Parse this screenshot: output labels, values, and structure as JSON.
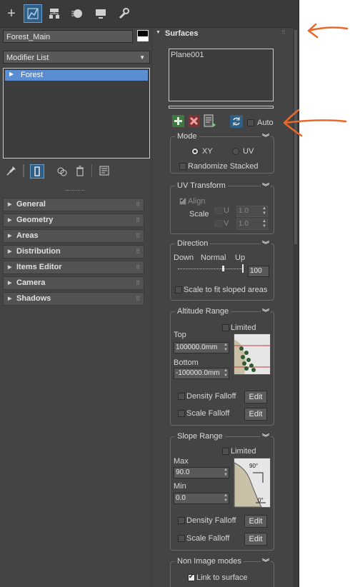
{
  "tabs": [
    {
      "icon": "plus-icon",
      "glyph": "+"
    },
    {
      "icon": "modify-icon",
      "glyph": "⬚"
    },
    {
      "icon": "hierarchy-icon",
      "glyph": "▀"
    },
    {
      "icon": "motion-icon",
      "glyph": "●"
    },
    {
      "icon": "display-icon",
      "glyph": "▬"
    },
    {
      "icon": "utilities-icon",
      "glyph": "🔧"
    }
  ],
  "object_name": "Forest_Main",
  "modifier_list": "Modifier List",
  "stack_item": "Forest",
  "rollups": [
    "General",
    "Geometry",
    "Areas",
    "Distribution",
    "Items Editor",
    "Camera",
    "Shadows"
  ],
  "surfaces": {
    "title": "Surfaces",
    "list_item": "Plane001",
    "auto_label": "Auto",
    "mode": {
      "title": "Mode",
      "xy": "XY",
      "uv": "UV",
      "randomize": "Randomize Stacked"
    },
    "uv_transform": {
      "title": "UV Transform",
      "align": "Align",
      "scale": "Scale",
      "u": "U",
      "v": "V",
      "u_value": "1.0",
      "v_value": "1.0"
    },
    "direction": {
      "title": "Direction",
      "down": "Down",
      "normal": "Normal",
      "up": "Up",
      "value": "100",
      "scale_slope": "Scale to fit sloped areas",
      "slider_level": 0.7
    },
    "altitude": {
      "title": "Altitude Range",
      "limited": "Limited",
      "top": "Top",
      "top_value": "100000.0mm",
      "bottom": "Bottom",
      "bottom_value": "-100000.0mm",
      "density_falloff": "Density Falloff",
      "scale_falloff": "Scale Falloff",
      "edit": "Edit"
    },
    "slope": {
      "title": "Slope Range",
      "limited": "Limited",
      "max": "Max",
      "max_value": "90.0",
      "min": "Min",
      "min_value": "0.0",
      "deg_top": "90°",
      "deg_bottom": "0°",
      "density_falloff": "Density Falloff",
      "scale_falloff": "Scale Falloff",
      "edit": "Edit"
    },
    "non_image": {
      "title": "Non Image modes",
      "link": "Link to surface"
    }
  },
  "colors": {
    "panel": "#444444",
    "accent_blue": "#5a8fd0",
    "annotation": "#e8692a"
  }
}
